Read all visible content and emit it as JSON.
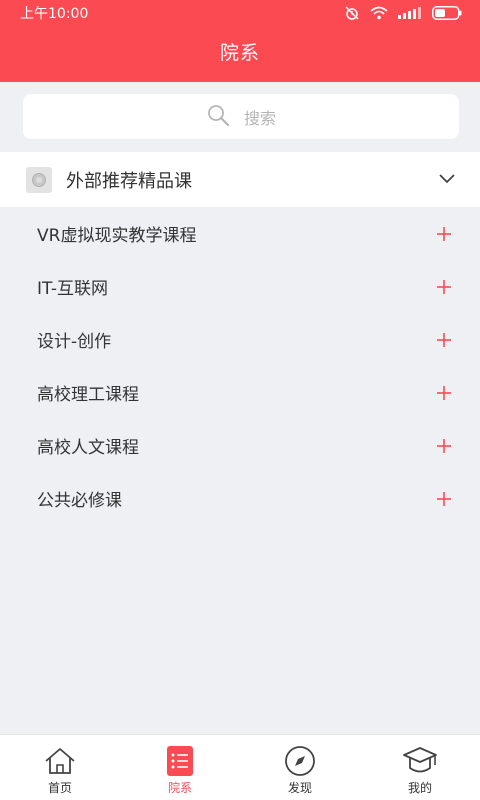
{
  "status_bar": {
    "time": "上午10:00"
  },
  "header": {
    "title": "院系"
  },
  "search": {
    "placeholder": "搜索"
  },
  "group": {
    "label": "外部推荐精品课",
    "expanded": true
  },
  "categories": [
    {
      "label": "VR虚拟现实教学课程"
    },
    {
      "label": "IT-互联网"
    },
    {
      "label": "设计-创作"
    },
    {
      "label": "高校理工课程"
    },
    {
      "label": "高校人文课程"
    },
    {
      "label": "公共必修课"
    }
  ],
  "tabbar": {
    "items": [
      {
        "label": "首页",
        "icon": "home-icon",
        "active": false
      },
      {
        "label": "院系",
        "icon": "list-icon",
        "active": true
      },
      {
        "label": "发现",
        "icon": "compass-icon",
        "active": false
      },
      {
        "label": "我的",
        "icon": "graduation-cap-icon",
        "active": false
      }
    ]
  },
  "colors": {
    "accent": "#fb4a52",
    "background": "#eef0f4",
    "text": "#333333"
  }
}
